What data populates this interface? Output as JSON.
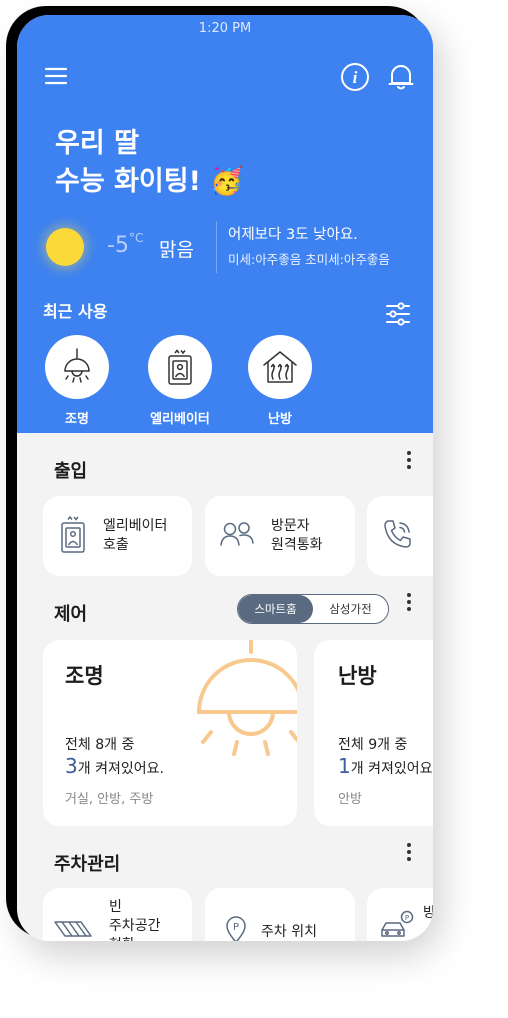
{
  "status": {
    "time": "1:20 PM"
  },
  "header": {
    "menu_icon": "menu-icon",
    "info_icon": "info-icon",
    "bell_icon": "bell-icon"
  },
  "greeting": {
    "line1": "우리 딸",
    "line2": "수능 화이팅! 🥳"
  },
  "weather": {
    "temp_value": "-5",
    "temp_unit": "°C",
    "condition": "맑음",
    "message": "어제보다 3도 낮아요.",
    "dust": "미세:아주좋음  초미세:아주좋음",
    "icon": "sun-icon"
  },
  "recent": {
    "title": "최근 사용",
    "items": [
      {
        "label": "조명",
        "icon": "lamp-icon"
      },
      {
        "label": "엘리베이터",
        "icon": "elevator-icon"
      },
      {
        "label": "난방",
        "icon": "heating-icon"
      }
    ]
  },
  "access": {
    "title": "출입",
    "cards": [
      {
        "label": "엘리베이터\n호출",
        "icon": "elevator-call-icon"
      },
      {
        "label": "방문자\n원격통화",
        "icon": "visitors-icon"
      },
      {
        "label": "",
        "icon": "phone-icon"
      }
    ]
  },
  "control": {
    "title": "제어",
    "toggle": {
      "active": "스마트홈",
      "inactive": "삼성가전"
    },
    "cards": [
      {
        "title": "조명",
        "total": "전체 8개 중",
        "on_count": "3",
        "on_suffix": "개 켜져있어요.",
        "rooms": "거실, 안방, 주방"
      },
      {
        "title": "난방",
        "total": "전체 9개 중",
        "on_count": "1",
        "on_suffix": "개 켜져있어요.",
        "rooms": "안방"
      }
    ]
  },
  "parking": {
    "title": "주차관리",
    "cards": [
      {
        "label": "빈\n주차공간\n현황",
        "icon": "parking-lot-icon"
      },
      {
        "label": "주차 위치",
        "icon": "parking-pin-icon"
      },
      {
        "label": "방",
        "icon": "car-icon"
      }
    ]
  },
  "colors": {
    "primary": "#3d82f0",
    "accent_lamp": "#f8c98f",
    "toggle_active": "#5a6a80"
  }
}
